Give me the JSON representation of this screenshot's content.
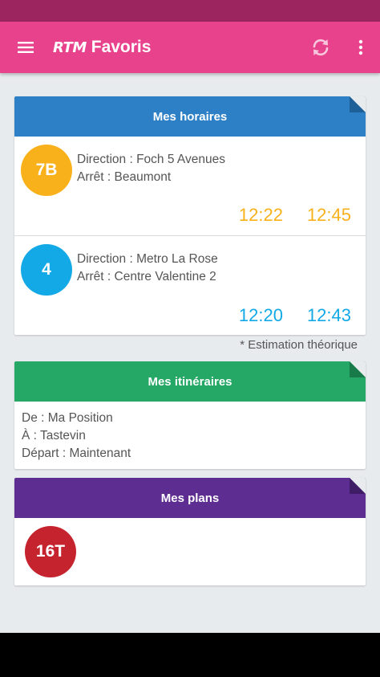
{
  "appbar": {
    "logo_text": "RTM",
    "title": "Favoris",
    "icons": [
      "menu-icon",
      "refresh-icon",
      "more-vert-icon"
    ]
  },
  "colors": {
    "status_bar": "#9c2560",
    "app_bar": "#e8428d",
    "horaires_header": "#2e80c6",
    "itineraires_header": "#25a766",
    "plans_header": "#5e2d91",
    "line_7B": "#f9b11b",
    "line_4": "#13a9e6",
    "line_16T": "#c5232d"
  },
  "horaires": {
    "title": "Mes horaires",
    "items": [
      {
        "line": "7B",
        "direction": "Direction : Foch 5 Avenues",
        "stop": "Arrêt : Beaumont",
        "times": [
          "12:22",
          "12:45"
        ]
      },
      {
        "line": "4",
        "direction": "Direction : Metro La Rose",
        "stop": "Arrêt : Centre Valentine 2",
        "times": [
          "12:20",
          "12:43"
        ]
      }
    ],
    "note": "* Estimation théorique"
  },
  "itineraires": {
    "title": "Mes itinéraires",
    "from": "De : Ma Position",
    "to": "À : Tastevin",
    "departure": "Départ : Maintenant"
  },
  "plans": {
    "title": "Mes plans",
    "items": [
      {
        "line": "16T"
      }
    ]
  }
}
